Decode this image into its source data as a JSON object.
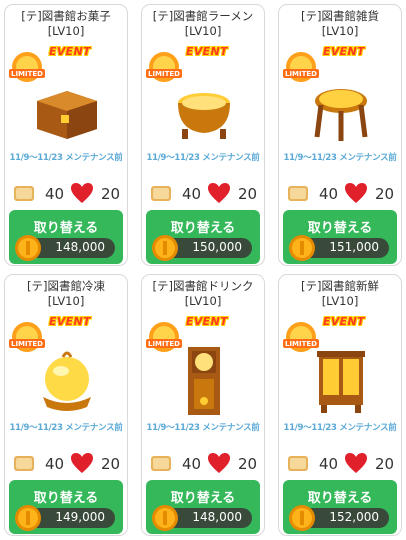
{
  "cards": [
    {
      "title1": "[テ]図書館お菓子",
      "title2": "[LV10]",
      "badge": "LIMITED",
      "event": "EVENT",
      "maintenance": "11/9～11/23 メンテナンス前",
      "stat_bread": "40",
      "stat_heart": "20",
      "button": "取り替える",
      "price": "148,000",
      "item_icon": "chest-icon"
    },
    {
      "title1": "[テ]図書館ラーメン",
      "title2": "[LV10]",
      "badge": "LIMITED",
      "event": "EVENT",
      "maintenance": "11/9～11/23 メンテナンス前",
      "stat_bread": "40",
      "stat_heart": "20",
      "button": "取り替える",
      "price": "150,000",
      "item_icon": "bathtub-icon"
    },
    {
      "title1": "[テ]図書館雑貨",
      "title2": "[LV10]",
      "badge": "LIMITED",
      "event": "EVENT",
      "maintenance": "11/9～11/23 メンテナンス前",
      "stat_bread": "40",
      "stat_heart": "20",
      "button": "取り替える",
      "price": "151,000",
      "item_icon": "round-table-icon"
    },
    {
      "title1": "[テ]図書館冷凍",
      "title2": "[LV10]",
      "badge": "LIMITED",
      "event": "EVENT",
      "maintenance": "11/9～11/23 メンテナンス前",
      "stat_bread": "40",
      "stat_heart": "20",
      "button": "取り替える",
      "price": "149,000",
      "item_icon": "globe-icon"
    },
    {
      "title1": "[テ]図書館ドリンク",
      "title2": "[LV10]",
      "badge": "LIMITED",
      "event": "EVENT",
      "maintenance": "11/9～11/23 メンテナンス前",
      "stat_bread": "40",
      "stat_heart": "20",
      "button": "取り替える",
      "price": "148,000",
      "item_icon": "grandfather-clock-icon"
    },
    {
      "title1": "[テ]図書館新鮮",
      "title2": "[LV10]",
      "badge": "LIMITED",
      "event": "EVENT",
      "maintenance": "11/9～11/23 メンテナンス前",
      "stat_bread": "40",
      "stat_heart": "20",
      "button": "取り替える",
      "price": "152,000",
      "item_icon": "cabinet-icon"
    }
  ],
  "colors": {
    "button_green": "#34b85a",
    "price_pill": "#3a4a3a",
    "maintenance_blue": "#5aa9d6",
    "event_red": "#ff3a1f"
  }
}
